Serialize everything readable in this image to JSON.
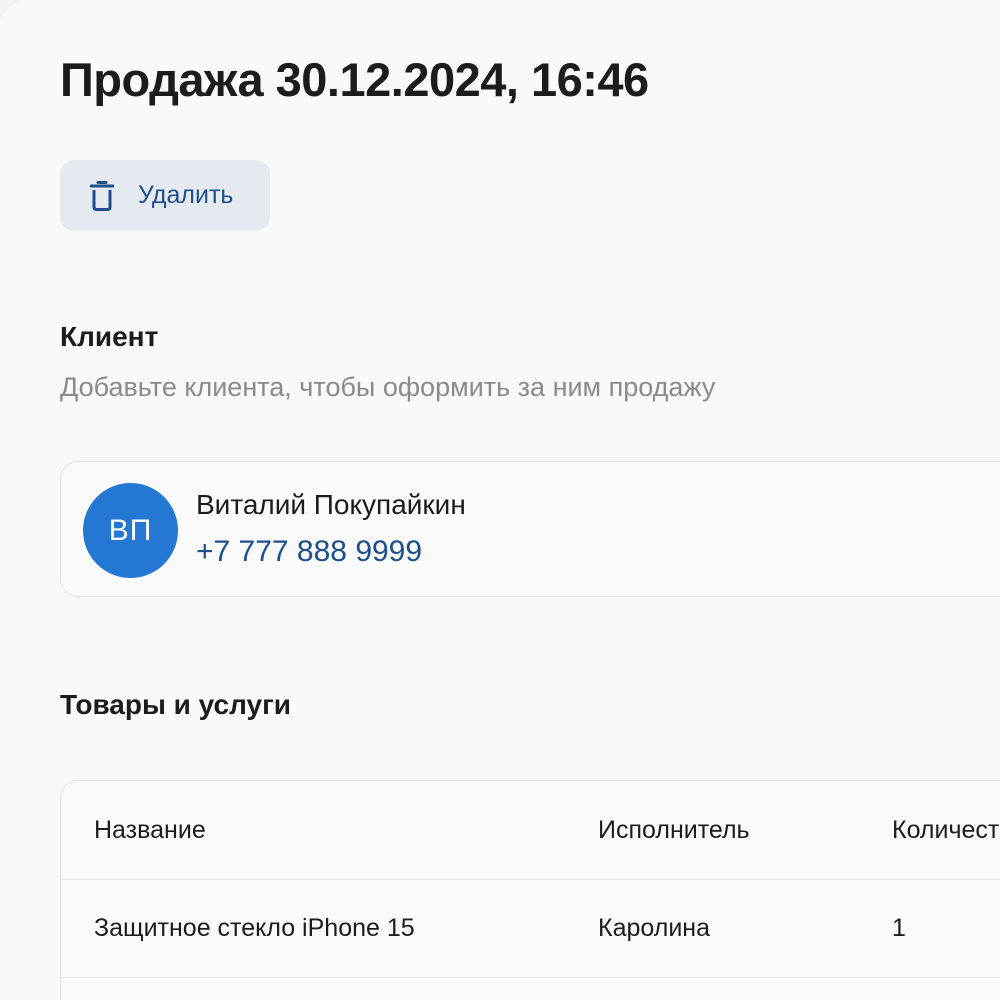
{
  "page": {
    "title": "Продажа 30.12.2024, 16:46"
  },
  "toolbar": {
    "delete_label": "Удалить",
    "delete_icon": "trash-icon"
  },
  "client_section": {
    "title": "Клиент",
    "subtitle": "Добавьте клиента, чтобы оформить за ним продажу",
    "client": {
      "initials": "ВП",
      "name": "Виталий Покупайкин",
      "phone": "+7 777 888 9999"
    }
  },
  "items_section": {
    "title": "Товары и услуги",
    "columns": [
      "Название",
      "Исполнитель",
      "Количест"
    ],
    "rows": [
      [
        "Защитное стекло iPhone 15",
        "Каролина",
        "1"
      ]
    ]
  },
  "colors": {
    "accent": "#1e4f8c",
    "avatar": "#2477d3",
    "button_bg": "#e5eaf1"
  }
}
